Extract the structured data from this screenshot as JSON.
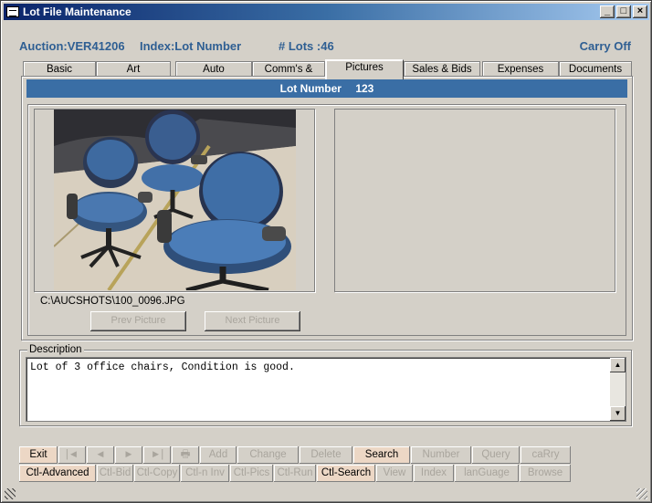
{
  "window": {
    "title": "Lot File Maintenance",
    "minimize": "_",
    "maximize": "□",
    "close": "×"
  },
  "header": {
    "auction": "Auction:VER41206",
    "index": "Index:Lot Number",
    "lots": "# Lots :46",
    "carry": "Carry Off"
  },
  "tabs": [
    {
      "label": "Basic"
    },
    {
      "label": "Art"
    },
    {
      "label": "Auto"
    },
    {
      "label": "Comm's & Notes"
    },
    {
      "label": "Pictures",
      "active": true
    },
    {
      "label": "Sales & Bids"
    },
    {
      "label": "Expenses"
    },
    {
      "label": "Documents"
    }
  ],
  "lot": {
    "label": "Lot Number",
    "value": "123"
  },
  "pictures": {
    "filename": "C:\\AUCSHOTS\\100_0096.JPG",
    "prev_label": "Prev Picture",
    "next_label": "Next Picture",
    "photo_subject": "office-chairs-photo"
  },
  "description": {
    "legend": "Description",
    "text": "Lot of 3 office chairs, Condition is good.",
    "scroll_up": "▲",
    "scroll_down": "▼"
  },
  "toolbar": {
    "row1": [
      {
        "label": "Exit",
        "enabled": true
      },
      {
        "label": "|◄",
        "icon": "first-record-icon"
      },
      {
        "label": "◄",
        "icon": "prev-record-icon"
      },
      {
        "label": "►",
        "icon": "next-record-icon"
      },
      {
        "label": "►|",
        "icon": "last-record-icon"
      },
      {
        "label": "🖶",
        "icon": "print-icon"
      },
      {
        "label": "Add"
      },
      {
        "label": "Change"
      },
      {
        "label": "Delete"
      },
      {
        "label": "Search",
        "enabled": true
      },
      {
        "label": "Number"
      },
      {
        "label": "Query"
      },
      {
        "label": "caRry"
      }
    ],
    "row2": [
      {
        "label": "Ctl-Advanced",
        "enabled": true
      },
      {
        "label": "Ctl-Bid"
      },
      {
        "label": "Ctl-Copy"
      },
      {
        "label": "Ctl-n Inv"
      },
      {
        "label": "Ctl-Pics"
      },
      {
        "label": "Ctl-Run"
      },
      {
        "label": "Ctl-Search",
        "enabled": true
      },
      {
        "label": "View"
      },
      {
        "label": "Index"
      },
      {
        "label": "lanGuage"
      },
      {
        "label": "Browse"
      }
    ]
  },
  "colors": {
    "accent": "#3a6ea5",
    "header_text": "#2f5f93",
    "enabled_button": "#ecd7c5"
  }
}
